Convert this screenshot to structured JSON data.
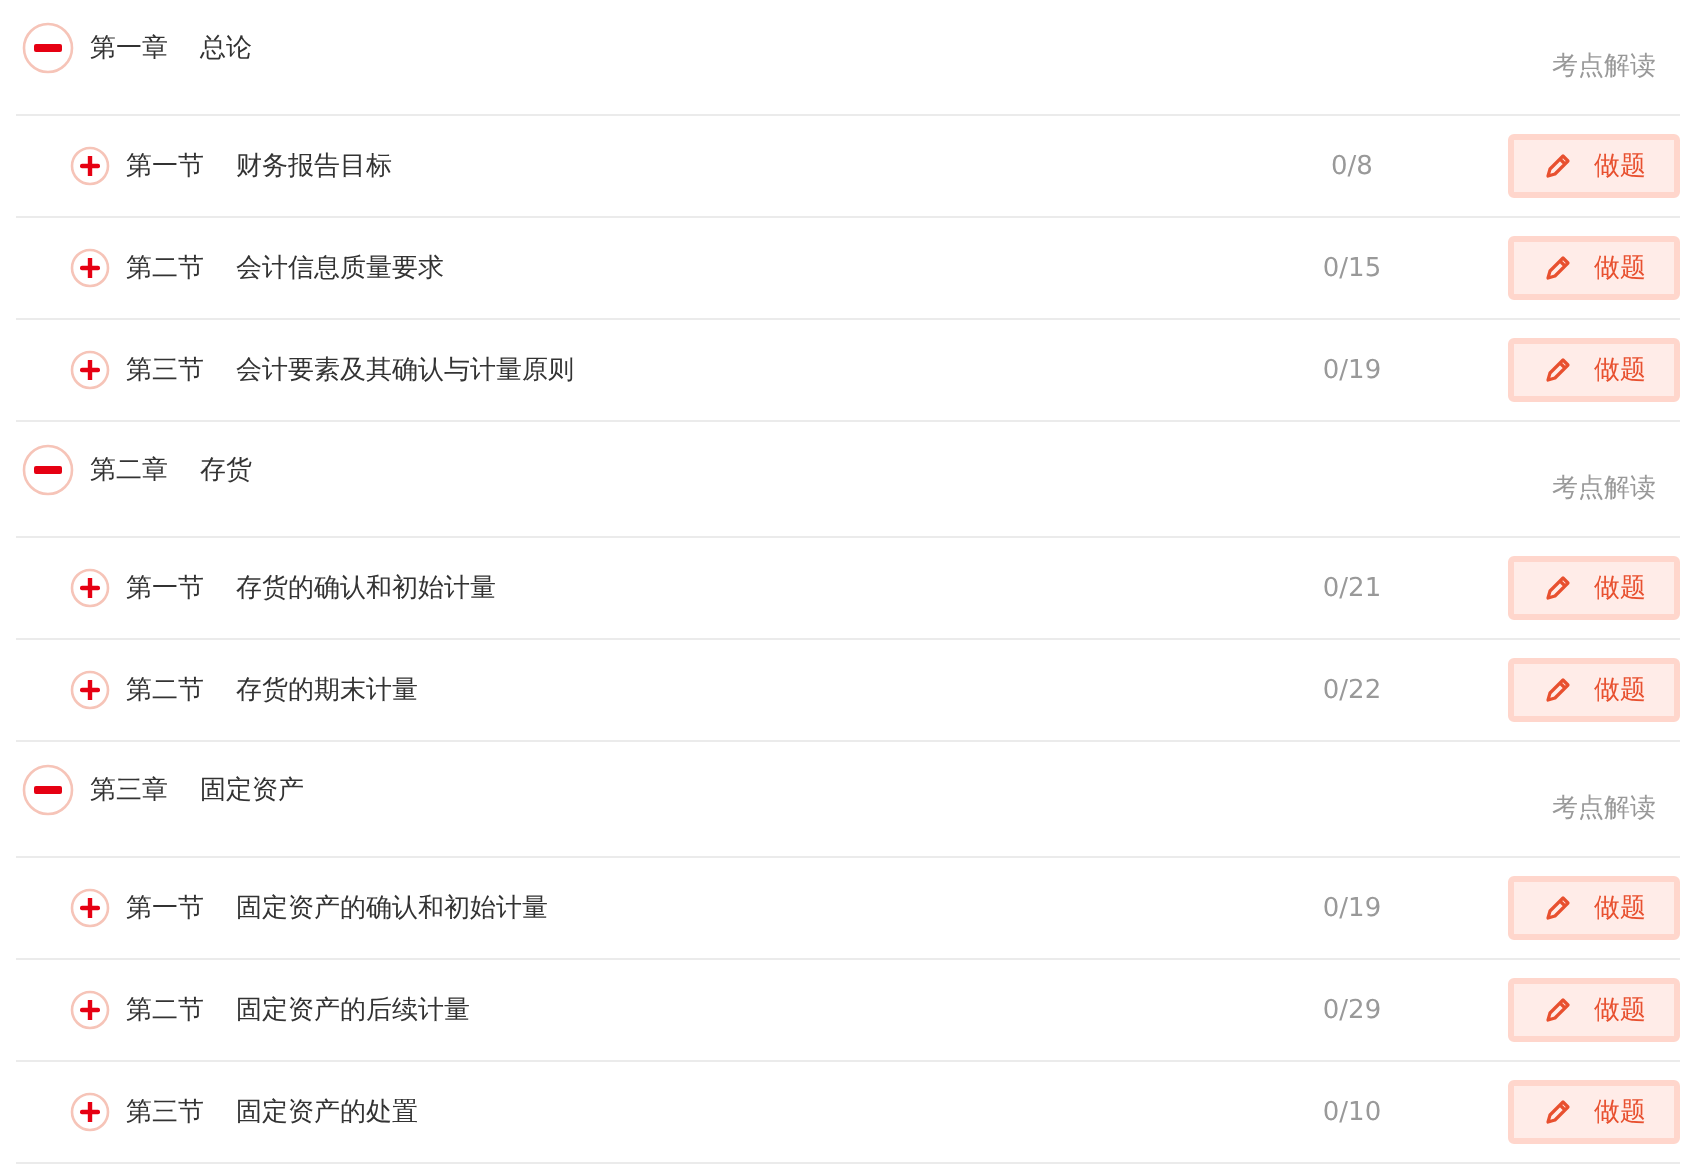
{
  "chapters": [
    {
      "number": "第一章",
      "title": "总论",
      "expanded": true,
      "link": "考点解读",
      "sections": [
        {
          "number": "第一节",
          "title": "财务报告目标",
          "expanded": false,
          "count": "0/8",
          "button": "做题"
        },
        {
          "number": "第二节",
          "title": "会计信息质量要求",
          "expanded": false,
          "count": "0/15",
          "button": "做题"
        },
        {
          "number": "第三节",
          "title": "会计要素及其确认与计量原则",
          "expanded": false,
          "count": "0/19",
          "button": "做题"
        }
      ]
    },
    {
      "number": "第二章",
      "title": "存货",
      "expanded": true,
      "link": "考点解读",
      "sections": [
        {
          "number": "第一节",
          "title": "存货的确认和初始计量",
          "expanded": false,
          "count": "0/21",
          "button": "做题"
        },
        {
          "number": "第二节",
          "title": "存货的期末计量",
          "expanded": false,
          "count": "0/22",
          "button": "做题"
        }
      ]
    },
    {
      "number": "第三章",
      "title": "固定资产",
      "expanded": true,
      "link": "考点解读",
      "sections": [
        {
          "number": "第一节",
          "title": "固定资产的确认和初始计量",
          "expanded": false,
          "count": "0/19",
          "button": "做题"
        },
        {
          "number": "第二节",
          "title": "固定资产的后续计量",
          "expanded": false,
          "count": "0/29",
          "button": "做题"
        },
        {
          "number": "第三节",
          "title": "固定资产的处置",
          "expanded": false,
          "count": "0/10",
          "button": "做题"
        }
      ]
    }
  ]
}
